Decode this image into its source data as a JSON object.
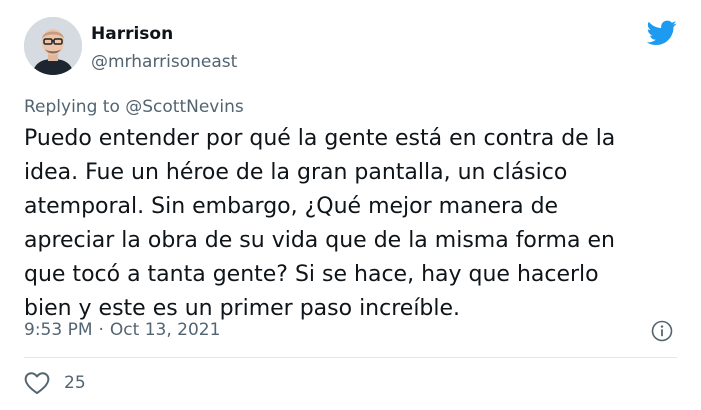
{
  "author": {
    "name": "Harrison",
    "handle": "@mrharrisoneast"
  },
  "reply": {
    "prefix": "Replying to",
    "mention": "@ScottNevins"
  },
  "tweet": {
    "text": "Puedo entender por qué la gente está en contra de la\nidea. Fue un héroe de la gran pantalla, un clásico\natemporal. Sin embargo, ¿Qué mejor manera de\napreciar la obra de su vida que de la misma forma en\nque tocó a tanta gente? Si se hace, hay que hacerlo\nbien y este es un primer paso increíble.",
    "time": "9:53 PM",
    "separator": "·",
    "date": "Oct 13, 2021"
  },
  "engagement": {
    "likes": "25"
  },
  "icons": {
    "brand": "twitter-bird-icon",
    "info": "info-icon",
    "like": "heart-icon"
  },
  "colors": {
    "brand": "#1d9bf0",
    "text": "#0f1419",
    "secondary": "#536471",
    "divider": "#e1e8ed"
  }
}
